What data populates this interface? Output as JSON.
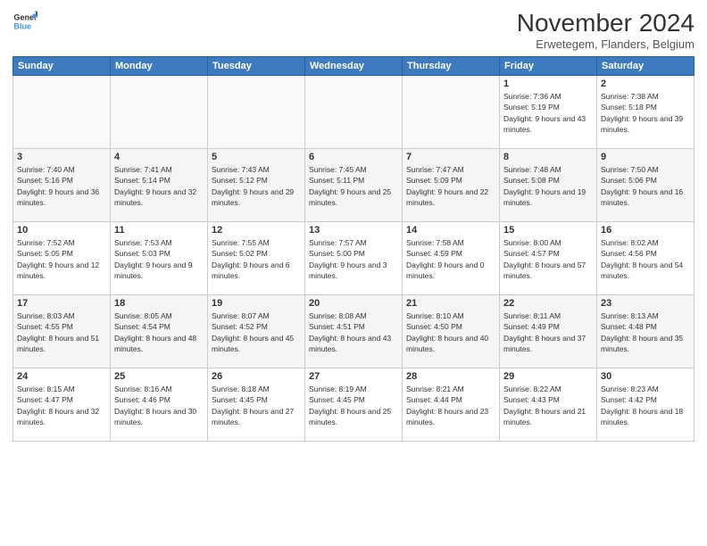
{
  "header": {
    "logo": {
      "line1": "General",
      "line2": "Blue"
    },
    "title": "November 2024",
    "subtitle": "Erwetegem, Flanders, Belgium"
  },
  "weekdays": [
    "Sunday",
    "Monday",
    "Tuesday",
    "Wednesday",
    "Thursday",
    "Friday",
    "Saturday"
  ],
  "weeks": [
    [
      {
        "day": "",
        "info": ""
      },
      {
        "day": "",
        "info": ""
      },
      {
        "day": "",
        "info": ""
      },
      {
        "day": "",
        "info": ""
      },
      {
        "day": "",
        "info": ""
      },
      {
        "day": "1",
        "info": "Sunrise: 7:36 AM\nSunset: 5:19 PM\nDaylight: 9 hours and 43 minutes."
      },
      {
        "day": "2",
        "info": "Sunrise: 7:38 AM\nSunset: 5:18 PM\nDaylight: 9 hours and 39 minutes."
      }
    ],
    [
      {
        "day": "3",
        "info": "Sunrise: 7:40 AM\nSunset: 5:16 PM\nDaylight: 9 hours and 36 minutes."
      },
      {
        "day": "4",
        "info": "Sunrise: 7:41 AM\nSunset: 5:14 PM\nDaylight: 9 hours and 32 minutes."
      },
      {
        "day": "5",
        "info": "Sunrise: 7:43 AM\nSunset: 5:12 PM\nDaylight: 9 hours and 29 minutes."
      },
      {
        "day": "6",
        "info": "Sunrise: 7:45 AM\nSunset: 5:11 PM\nDaylight: 9 hours and 25 minutes."
      },
      {
        "day": "7",
        "info": "Sunrise: 7:47 AM\nSunset: 5:09 PM\nDaylight: 9 hours and 22 minutes."
      },
      {
        "day": "8",
        "info": "Sunrise: 7:48 AM\nSunset: 5:08 PM\nDaylight: 9 hours and 19 minutes."
      },
      {
        "day": "9",
        "info": "Sunrise: 7:50 AM\nSunset: 5:06 PM\nDaylight: 9 hours and 16 minutes."
      }
    ],
    [
      {
        "day": "10",
        "info": "Sunrise: 7:52 AM\nSunset: 5:05 PM\nDaylight: 9 hours and 12 minutes."
      },
      {
        "day": "11",
        "info": "Sunrise: 7:53 AM\nSunset: 5:03 PM\nDaylight: 9 hours and 9 minutes."
      },
      {
        "day": "12",
        "info": "Sunrise: 7:55 AM\nSunset: 5:02 PM\nDaylight: 9 hours and 6 minutes."
      },
      {
        "day": "13",
        "info": "Sunrise: 7:57 AM\nSunset: 5:00 PM\nDaylight: 9 hours and 3 minutes."
      },
      {
        "day": "14",
        "info": "Sunrise: 7:58 AM\nSunset: 4:59 PM\nDaylight: 9 hours and 0 minutes."
      },
      {
        "day": "15",
        "info": "Sunrise: 8:00 AM\nSunset: 4:57 PM\nDaylight: 8 hours and 57 minutes."
      },
      {
        "day": "16",
        "info": "Sunrise: 8:02 AM\nSunset: 4:56 PM\nDaylight: 8 hours and 54 minutes."
      }
    ],
    [
      {
        "day": "17",
        "info": "Sunrise: 8:03 AM\nSunset: 4:55 PM\nDaylight: 8 hours and 51 minutes."
      },
      {
        "day": "18",
        "info": "Sunrise: 8:05 AM\nSunset: 4:54 PM\nDaylight: 8 hours and 48 minutes."
      },
      {
        "day": "19",
        "info": "Sunrise: 8:07 AM\nSunset: 4:52 PM\nDaylight: 8 hours and 45 minutes."
      },
      {
        "day": "20",
        "info": "Sunrise: 8:08 AM\nSunset: 4:51 PM\nDaylight: 8 hours and 43 minutes."
      },
      {
        "day": "21",
        "info": "Sunrise: 8:10 AM\nSunset: 4:50 PM\nDaylight: 8 hours and 40 minutes."
      },
      {
        "day": "22",
        "info": "Sunrise: 8:11 AM\nSunset: 4:49 PM\nDaylight: 8 hours and 37 minutes."
      },
      {
        "day": "23",
        "info": "Sunrise: 8:13 AM\nSunset: 4:48 PM\nDaylight: 8 hours and 35 minutes."
      }
    ],
    [
      {
        "day": "24",
        "info": "Sunrise: 8:15 AM\nSunset: 4:47 PM\nDaylight: 8 hours and 32 minutes."
      },
      {
        "day": "25",
        "info": "Sunrise: 8:16 AM\nSunset: 4:46 PM\nDaylight: 8 hours and 30 minutes."
      },
      {
        "day": "26",
        "info": "Sunrise: 8:18 AM\nSunset: 4:45 PM\nDaylight: 8 hours and 27 minutes."
      },
      {
        "day": "27",
        "info": "Sunrise: 8:19 AM\nSunset: 4:45 PM\nDaylight: 8 hours and 25 minutes."
      },
      {
        "day": "28",
        "info": "Sunrise: 8:21 AM\nSunset: 4:44 PM\nDaylight: 8 hours and 23 minutes."
      },
      {
        "day": "29",
        "info": "Sunrise: 8:22 AM\nSunset: 4:43 PM\nDaylight: 8 hours and 21 minutes."
      },
      {
        "day": "30",
        "info": "Sunrise: 8:23 AM\nSunset: 4:42 PM\nDaylight: 8 hours and 18 minutes."
      }
    ]
  ]
}
